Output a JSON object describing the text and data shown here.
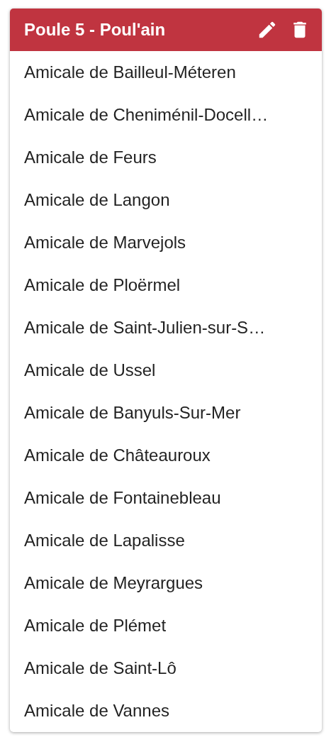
{
  "card": {
    "title": "Poule 5 - Poul'ain",
    "items": [
      "Amicale de Bailleul-Méteren",
      "Amicale de Cheniménil-Docell…",
      "Amicale de Feurs",
      "Amicale de Langon",
      "Amicale de Marvejols",
      "Amicale de Ploërmel",
      "Amicale de Saint-Julien-sur-S…",
      "Amicale de Ussel",
      "Amicale de Banyuls-Sur-Mer",
      "Amicale de Châteauroux",
      "Amicale de Fontainebleau",
      "Amicale de Lapalisse",
      "Amicale de Meyrargues",
      "Amicale de Plémet",
      "Amicale de Saint-Lô",
      "Amicale de Vannes"
    ]
  }
}
